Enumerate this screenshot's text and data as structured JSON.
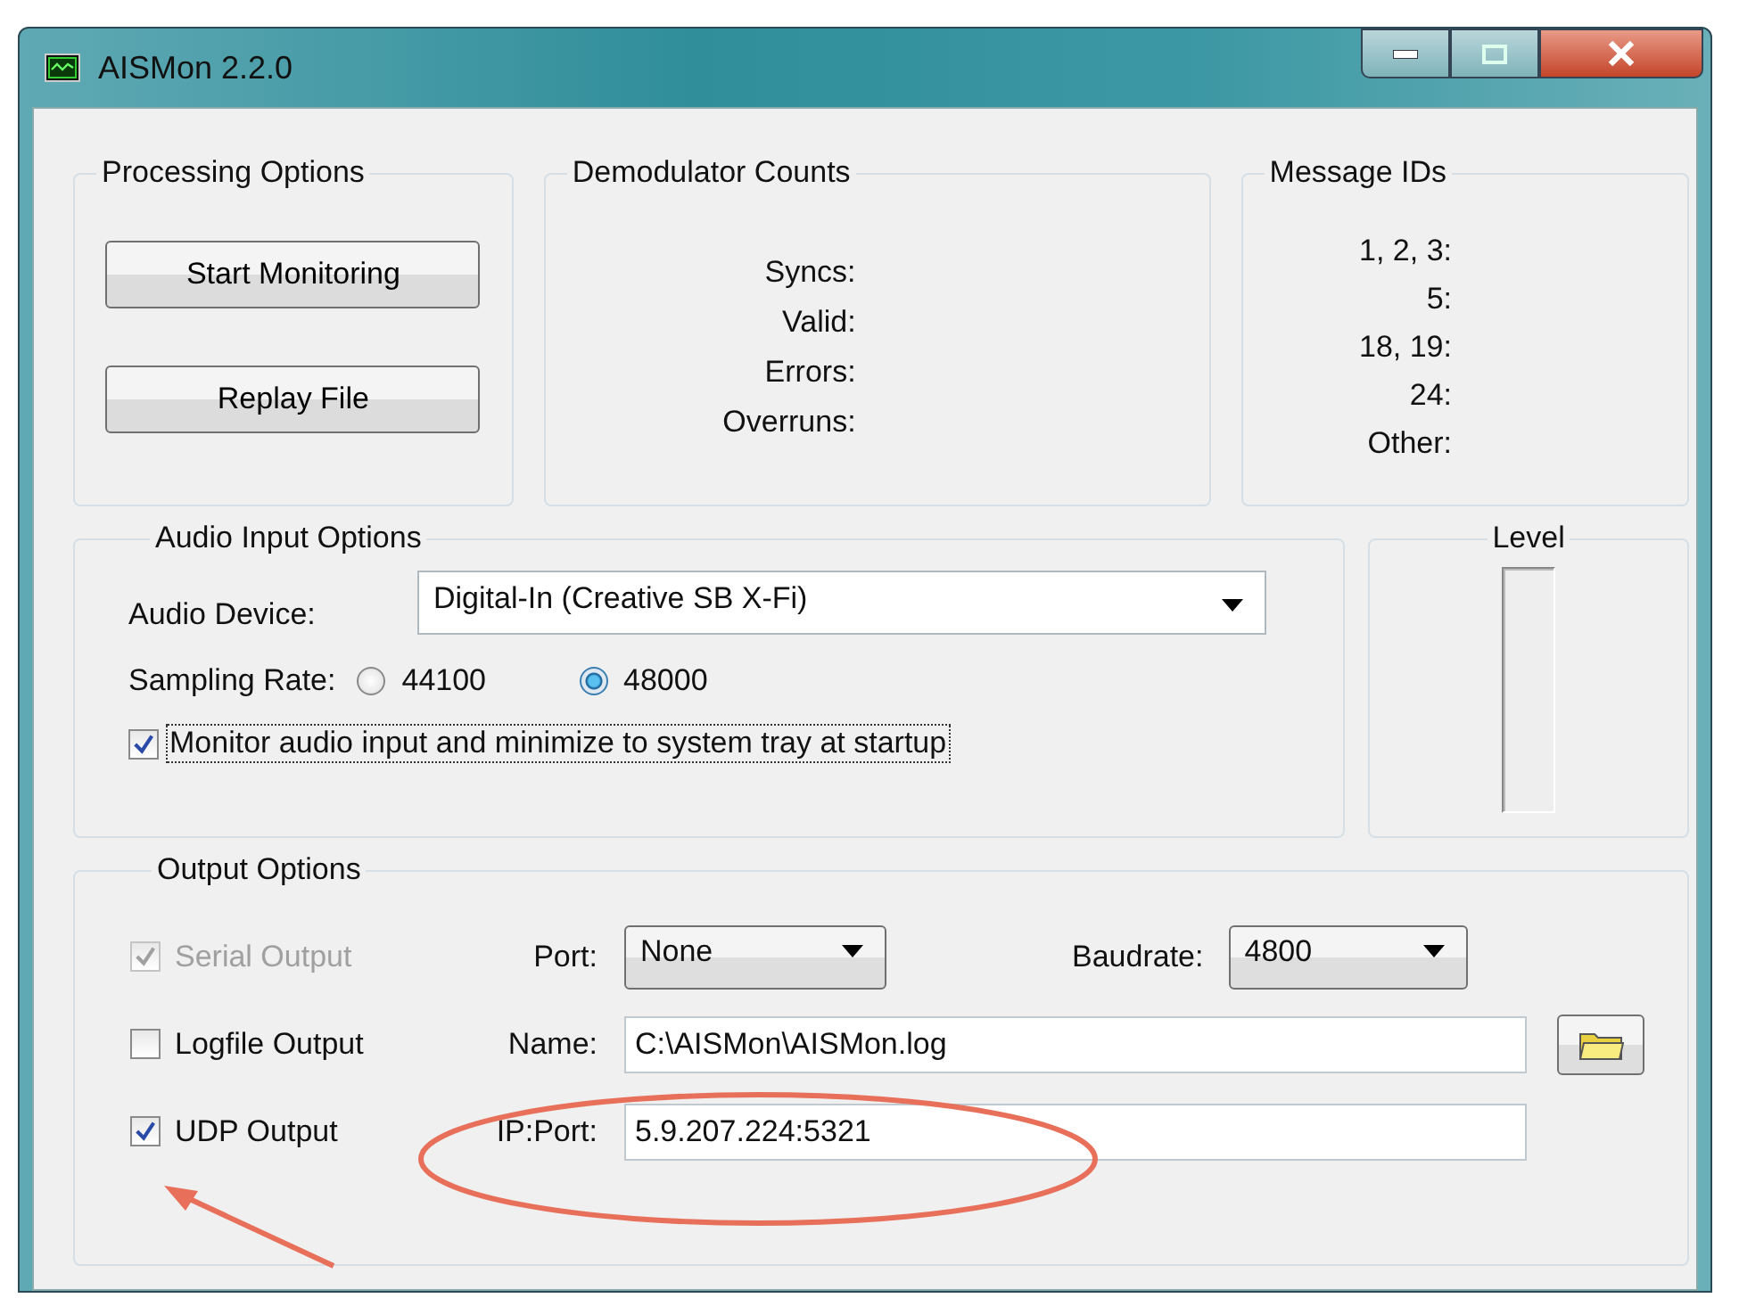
{
  "window": {
    "title": "AISMon 2.2.0"
  },
  "processing_options": {
    "title": "Processing Options",
    "buttons": [
      "Start Monitoring",
      "Replay File"
    ]
  },
  "demodulator_counts": {
    "title": "Demodulator Counts",
    "labels": [
      "Syncs:",
      "Valid:",
      "Errors:",
      "Overruns:"
    ]
  },
  "message_ids": {
    "title": "Message IDs",
    "labels": [
      "1, 2, 3:",
      "5:",
      "18, 19:",
      "24:",
      "Other:"
    ]
  },
  "audio_input_options": {
    "title": "Audio Input Options",
    "device_label": "Audio Device:",
    "device": "Digital-In (Creative SB X-Fi)",
    "sampling_rate_label": "Sampling Rate:",
    "sampling_rates": [
      {
        "label": "44100",
        "selected": false
      },
      {
        "label": "48000",
        "selected": true
      }
    ],
    "monitor_option": {
      "label": "Monitor audio input and minimize to system tray at startup",
      "checked": true
    }
  },
  "level_meter": {
    "title": "Level",
    "level": 0
  },
  "output_options": {
    "title": "Output Options",
    "serial": {
      "label": "Serial Output",
      "checked": true,
      "disabled": true,
      "port_label": "Port:",
      "port": "None",
      "baudrate_label": "Baudrate:",
      "baudrate": "4800"
    },
    "logfile": {
      "label": "Logfile Output",
      "checked": false,
      "disabled": false,
      "name_label": "Name:",
      "name": "C:\\AISMon\\AISMon.log"
    },
    "udp": {
      "label": "UDP Output",
      "checked": true,
      "disabled": false,
      "address_label": "IP:Port:",
      "address": "5.9.207.224:5321"
    }
  },
  "annotations": [
    {
      "kind": "ellipse"
    },
    {
      "kind": "arrow"
    }
  ]
}
